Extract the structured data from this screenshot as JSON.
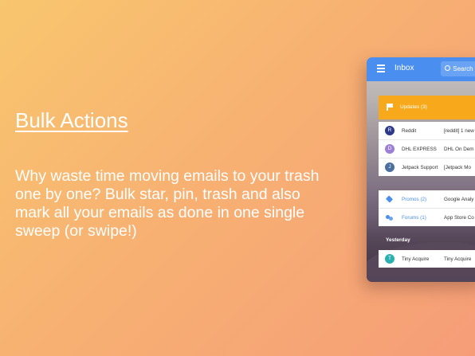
{
  "page": {
    "heading": "Bulk Actions",
    "description": "Why waste time moving emails to your trash one by one? Bulk star, pin, trash and also mark all your emails as done in one single sweep (or swipe!)"
  },
  "app": {
    "title": "Inbox",
    "search_label": "Search",
    "updates_label": "Updates (3)",
    "updates_color": "#f8a91b",
    "accent_color": "#4a8ef0",
    "emails": [
      {
        "initial": "R",
        "sender": "Reddit",
        "subject": "[reddit] 1 new",
        "color": "#2d3a8c"
      },
      {
        "initial": "D",
        "sender": "DHL EXPRESS",
        "subject": "DHL On Dem",
        "color": "#9c7fd6"
      },
      {
        "initial": "J",
        "sender": "Jetpack Support",
        "subject": "[Jetpack Mo",
        "color": "#4a6fa0"
      }
    ],
    "categories": [
      {
        "label": "Promos (2)",
        "subject": "Google Analy",
        "icon": "tag-icon"
      },
      {
        "label": "Forums (1)",
        "subject": "App Store Co",
        "icon": "people-icon"
      }
    ],
    "section_yesterday": "Yesterday",
    "yesterday_emails": [
      {
        "initial": "T",
        "sender": "Tiny Acquire",
        "subject": "Tiny Acquire",
        "color": "#2bb0b0"
      }
    ]
  }
}
